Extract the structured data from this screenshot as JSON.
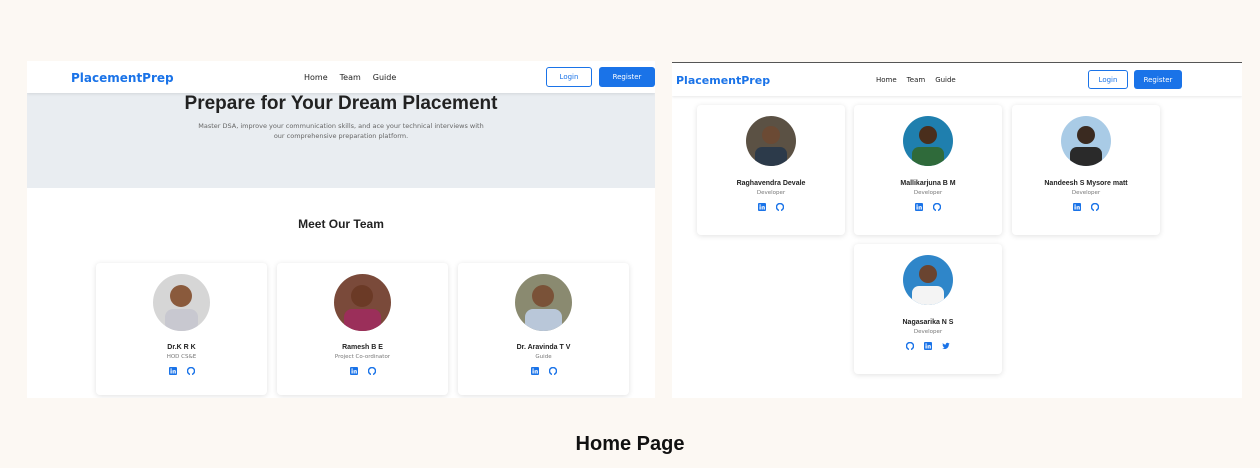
{
  "left": {
    "brand": "PlacementPrep",
    "nav": [
      "Home",
      "Team",
      "Guide"
    ],
    "login": "Login",
    "register": "Register",
    "hero_title": "Prepare for Your Dream Placement",
    "hero_subtitle": "Master DSA, improve your communication skills, and ace your technical interviews with our comprehensive preparation platform.",
    "team_title": "Meet Our Team",
    "members": [
      {
        "name": "Dr.K R K",
        "role": "HOD CS&E",
        "icons": [
          "linkedin-icon",
          "github-icon"
        ]
      },
      {
        "name": "Ramesh B E",
        "role": "Project Co-ordinator",
        "icons": [
          "linkedin-icon",
          "github-icon"
        ]
      },
      {
        "name": "Dr. Aravinda T V",
        "role": "Guide",
        "icons": [
          "linkedin-icon",
          "github-icon"
        ]
      }
    ]
  },
  "right": {
    "brand": "PlacementPrep",
    "nav": [
      "Home",
      "Team",
      "Guide"
    ],
    "login": "Login",
    "register": "Register",
    "members": [
      {
        "name": "Raghavendra Devale",
        "role": "Developer",
        "icons": [
          "linkedin-icon",
          "github-icon"
        ]
      },
      {
        "name": "Mallikarjuna B M",
        "role": "Developer",
        "icons": [
          "linkedin-icon",
          "github-icon"
        ]
      },
      {
        "name": "Nandeesh S Mysore matt",
        "role": "Developer",
        "icons": [
          "linkedin-icon",
          "github-icon"
        ]
      },
      {
        "name": "Nagasarika N S",
        "role": "Developer",
        "icons": [
          "github-icon",
          "linkedin-icon",
          "twitter-icon"
        ]
      }
    ]
  },
  "caption": "Home Page",
  "colors": {
    "accent": "#1a73e8",
    "hero_bg": "#e9edf1",
    "page_bg": "#fcf8f3"
  }
}
